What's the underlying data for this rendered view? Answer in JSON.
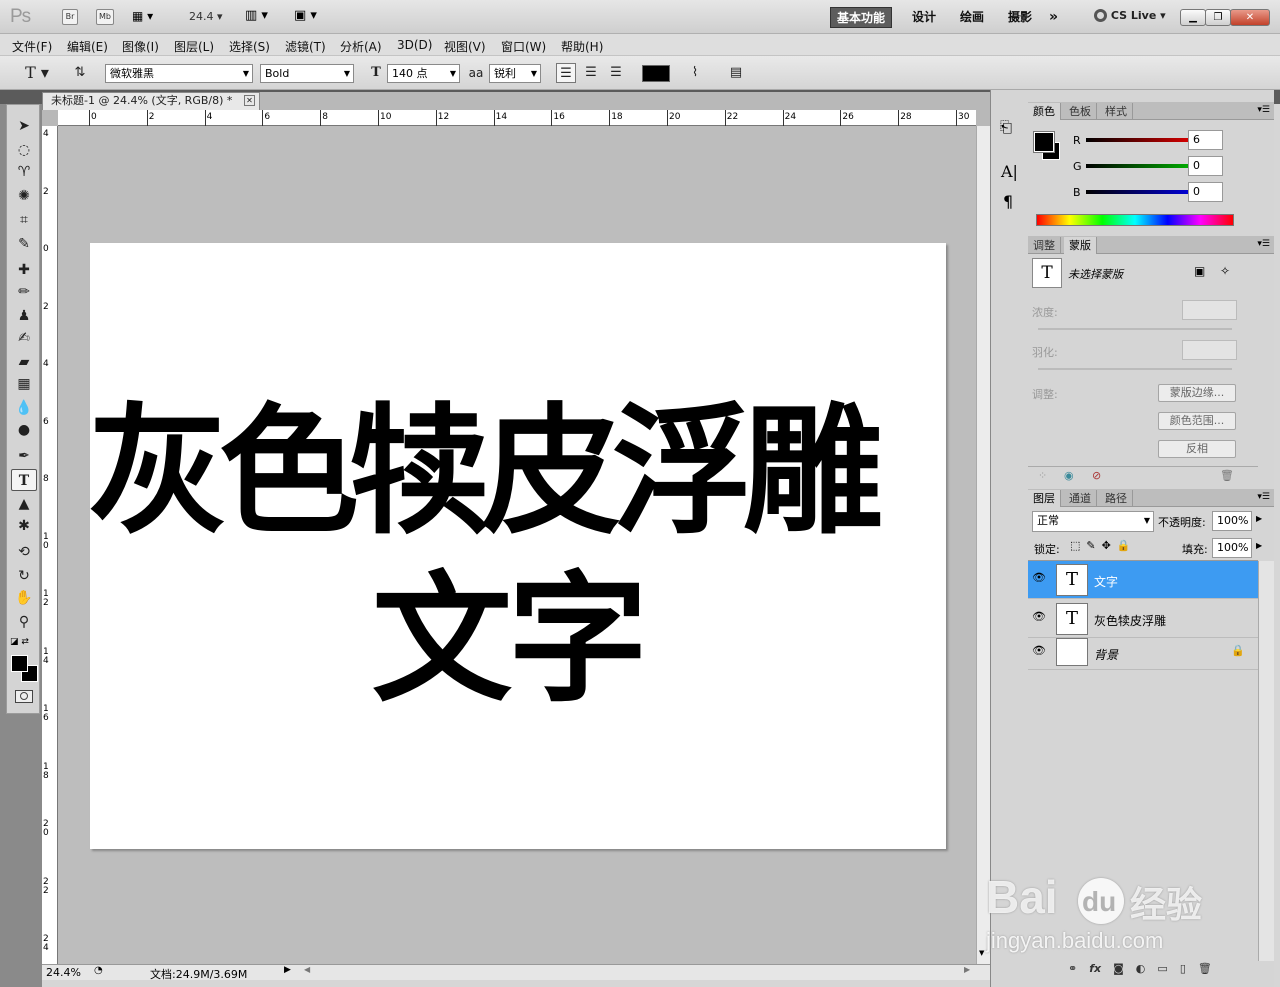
{
  "topbar": {
    "logo": "Ps",
    "bridge": "Br",
    "minibridge": "Mb",
    "zoom": "24.4",
    "workspaces": [
      "基本功能",
      "设计",
      "绘画",
      "摄影"
    ],
    "more": "»",
    "cslive": "CS Live"
  },
  "menu": [
    "文件(F)",
    "编辑(E)",
    "图像(I)",
    "图层(L)",
    "选择(S)",
    "滤镜(T)",
    "分析(A)",
    "3D(D)",
    "视图(V)",
    "窗口(W)",
    "帮助(H)"
  ],
  "options": {
    "font_family": "微软雅黑",
    "font_style": "Bold",
    "font_size": "140 点",
    "antialias_label": "aa",
    "antialias": "锐利",
    "color_hex": "#000000"
  },
  "document": {
    "tab_title": "未标题-1 @ 24.4% (文字, RGB/8) *",
    "line1": "灰色犊皮浮雕",
    "line2": "文字",
    "ruler_h": [
      "0",
      "2",
      "4",
      "6",
      "8",
      "10",
      "12",
      "14",
      "16",
      "18",
      "20",
      "22",
      "24",
      "26",
      "28",
      "30"
    ],
    "ruler_v": [
      "4",
      "2",
      "0",
      "2",
      "4",
      "6",
      "8",
      "1 0",
      "1 2",
      "1 4",
      "1 6",
      "1 8",
      "2 0",
      "2 2",
      "2 4"
    ]
  },
  "status": {
    "zoom": "24.4%",
    "doc": "文档:24.9M/3.69M"
  },
  "color_panel": {
    "tabs": [
      "颜色",
      "色板",
      "样式"
    ],
    "r_label": "R",
    "r": "6",
    "g_label": "G",
    "g": "0",
    "b_label": "B",
    "b": "0"
  },
  "masks_panel": {
    "tabs": [
      "调整",
      "蒙版"
    ],
    "status": "未选择蒙版",
    "density": "浓度:",
    "feather": "羽化:",
    "refine": "调整:",
    "edge_btn": "蒙版边缘...",
    "range_btn": "颜色范围...",
    "invert_btn": "反相"
  },
  "layers_panel": {
    "tabs": [
      "图层",
      "通道",
      "路径"
    ],
    "blend": "正常",
    "opacity_label": "不透明度:",
    "opacity": "100%",
    "lock_label": "锁定:",
    "fill_label": "填充:",
    "fill": "100%",
    "layers": [
      {
        "name": "文字",
        "thumb": "T",
        "selected": true
      },
      {
        "name": "灰色犊皮浮雕",
        "thumb": "T",
        "selected": false
      },
      {
        "name": "背景",
        "thumb": "",
        "selected": false
      }
    ],
    "footer_fx": "fx"
  },
  "watermark": {
    "brand": "Bai",
    "brand2": "du",
    "suffix": "经验",
    "url": "jingyan.baidu.com"
  },
  "colors": {
    "accent_selection": "#3d9bf2",
    "dark_chrome": "#5b5b5b"
  }
}
